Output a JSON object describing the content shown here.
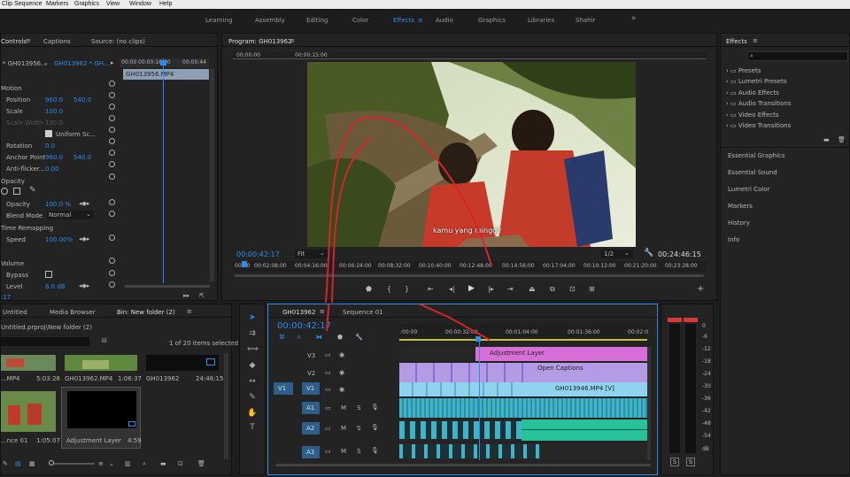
{
  "menu": [
    "Clip",
    "Sequence",
    "Markers",
    "Graphics",
    "View",
    "Window",
    "Help"
  ],
  "workspaces": [
    "Learning",
    "Assembly",
    "Editing",
    "Color",
    "Effects",
    "Audio",
    "Graphics",
    "Libraries",
    "Shahir"
  ],
  "ws_more": "»",
  "ec": {
    "tabs": [
      "Controls",
      "Captions",
      "Source: (no clips)"
    ],
    "clip_sel": "* GH013956...",
    "seq_sel": "GH013962 * GH...",
    "mini_times": [
      "00:00",
      "00:00:16:00",
      "00:00:44"
    ],
    "clip_name": "GH013956.MP4",
    "motion": "Motion",
    "position": "Position",
    "pos_x": "960.0",
    "pos_y": "540.0",
    "scale": "Scale",
    "scale_val": "100.0",
    "scale_width": "Scale Width",
    "scale_width_val": "100.0",
    "uniform": "Uniform Sc...",
    "rotation": "Rotation",
    "rotation_val": "0.0",
    "anchor": "Anchor Point",
    "anc_x": "960.0",
    "anc_y": "540.0",
    "flicker": "Anti-flicker...",
    "flicker_val": "0.00",
    "opacity_group": "Opacity",
    "opacity": "Opacity",
    "opacity_val": "100.0 %",
    "blend": "Blend Mode",
    "blend_val": "Normal",
    "remap": "Time Remapping",
    "speed": "Speed",
    "speed_val": "100.00%",
    "volume": "Volume",
    "bypass": "Bypass",
    "level": "Level",
    "level_val": "6.0 dB",
    "bottom_time": ":17"
  },
  "program": {
    "title": "Program: GH013962",
    "caption": "kamu yang minggir",
    "timecode": "00:00:42:17",
    "fit": "Fit",
    "res": "1/2",
    "duration": "00:24:46:15",
    "ruler": [
      "00:00",
      "00:02:08:00",
      "00:04:16:00",
      "00:06:24:00",
      "00:08:32:00",
      "00:10:40:00",
      "00:12:48:00",
      "00:14:56:00",
      "00:17:04:00",
      "00:19:12:00",
      "00:21:20:00",
      "00:23:28:00"
    ],
    "top_ruler": [
      "00:00:00",
      "00:00:15:00"
    ]
  },
  "effects": {
    "title": "Effects",
    "items": [
      "Presets",
      "Lumetri Presets",
      "Audio Effects",
      "Audio Transitions",
      "Video Effects",
      "Video Transitions"
    ],
    "panels": [
      "Essential Graphics",
      "Essential Sound",
      "Lumetri Color",
      "Markers",
      "History",
      "Info"
    ]
  },
  "project": {
    "tabs": [
      "Untitled",
      "Media Browser",
      "Bin: New folder (2)"
    ],
    "path": "Untitled.prproj\\New folder (2)",
    "count": "1 of 20 items selected",
    "items": [
      {
        "name": "...MP4",
        "dur": "5:03:26"
      },
      {
        "name": "GH013962.MP4",
        "dur": "1:06:37"
      },
      {
        "name": "GH013962",
        "dur": "24:46:15"
      },
      {
        "name": "...nce 01",
        "dur": "1:05:07"
      },
      {
        "name": "Adjustment Layer",
        "dur": "4:59"
      }
    ]
  },
  "timeline": {
    "tabs": [
      "GH013962",
      "Sequence 01"
    ],
    "timecode": "00:00:42:17",
    "ruler": [
      ":00:00",
      "00:00:32:00",
      "00:01:04:00",
      "00:01:36:00",
      "00:02:0"
    ],
    "tracks": [
      "V3",
      "V2",
      "V1",
      "A1",
      "A2",
      "A3"
    ],
    "src_v1": "V1",
    "src_a1": "A1",
    "clips": {
      "adjust": "Adjustment Layer",
      "captions": "Open Captions",
      "v1": "GH013946.MP4 [V]"
    },
    "db": [
      "0",
      "-6",
      "-12",
      "-18",
      "-24",
      "-30",
      "-36",
      "-42",
      "-48",
      "-54",
      "dB"
    ],
    "solo": [
      "S",
      "S"
    ]
  },
  "colors": {
    "accent": "#2d8ceb",
    "adjust": "#d86fd8",
    "clip_v": "#8fd3ef",
    "clip_purple": "#b49be6",
    "audio": "#3fb3c7",
    "audio2": "#27c29a"
  }
}
